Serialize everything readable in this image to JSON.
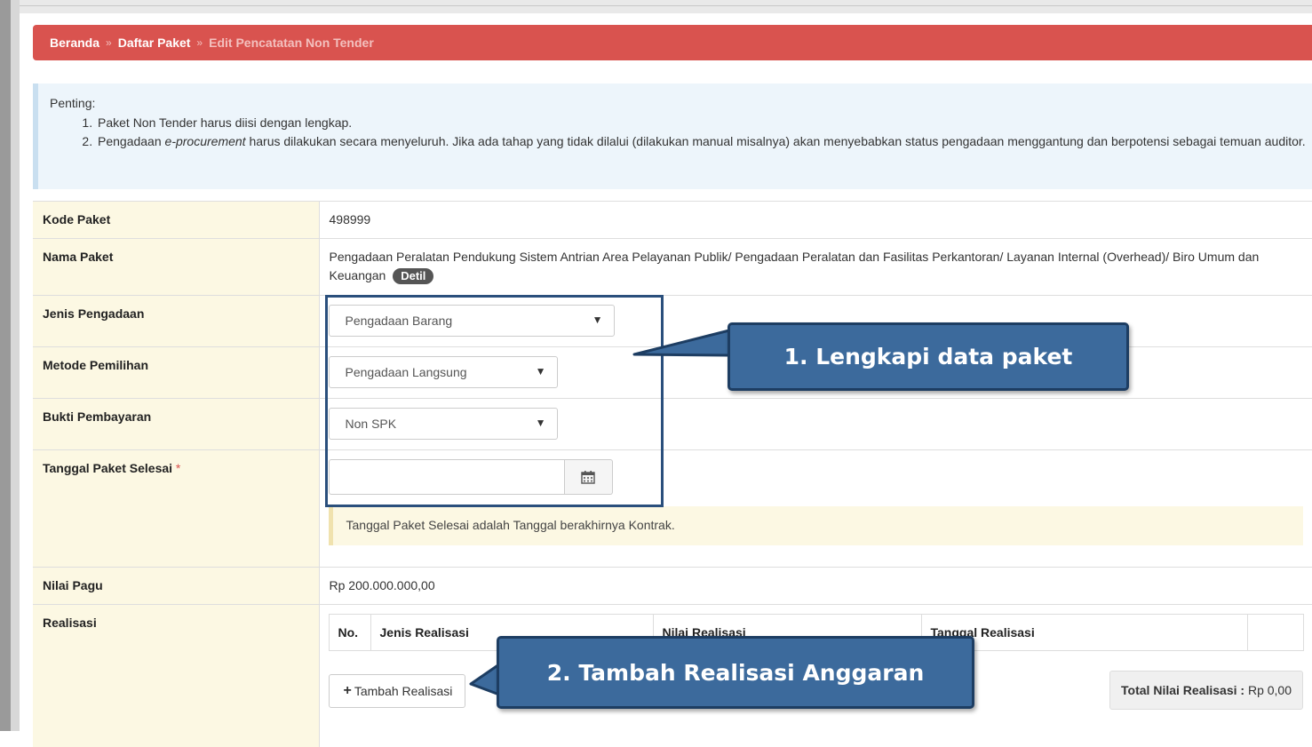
{
  "breadcrumb": {
    "home": "Beranda",
    "list": "Daftar Paket",
    "current": "Edit Pencatatan Non Tender",
    "separator": "»"
  },
  "alert": {
    "title": "Penting:",
    "item1": "Paket Non Tender harus diisi dengan lengkap.",
    "item2_prefix": "Pengadaan ",
    "item2_emph": "e-procurement",
    "item2_suffix": " harus dilakukan secara menyeluruh. Jika ada tahap yang tidak dilalui (dilakukan manual misalnya) akan menyebabkan status pengadaan menggantung dan berpotensi sebagai temuan auditor."
  },
  "form": {
    "kode_label": "Kode Paket",
    "kode_value": "498999",
    "nama_label": "Nama Paket",
    "nama_value": "Pengadaan Peralatan Pendukung Sistem Antrian Area Pelayanan Publik/ Pengadaan Peralatan dan Fasilitas Perkantoran/ Layanan Internal (Overhead)/ Biro Umum dan Keuangan",
    "detil_label": "Detil",
    "jenis_label": "Jenis Pengadaan",
    "jenis_value": "Pengadaan Barang",
    "metode_label": "Metode Pemilihan",
    "metode_value": "Pengadaan Langsung",
    "bukti_label": "Bukti Pembayaran",
    "bukti_value": "Non SPK",
    "tanggal_label": "Tanggal Paket Selesai",
    "required_mark": "*",
    "tanggal_value": "",
    "tanggal_note": "Tanggal Paket Selesai adalah Tanggal berakhirnya Kontrak.",
    "pagu_label": "Nilai Pagu",
    "pagu_value": "Rp 200.000.000,00",
    "realisasi_label": "Realisasi"
  },
  "realisasi_table": {
    "headers": [
      "No.",
      "Jenis Realisasi",
      "Nilai Realisasi",
      "Tanggal Realisasi",
      ""
    ]
  },
  "buttons": {
    "tambah_realisasi": "Tambah Realisasi"
  },
  "total": {
    "label": "Total Nilai Realisasi :",
    "value": "Rp 0,00"
  },
  "callouts": {
    "c1": "1.   Lengkapi data paket",
    "c2": "2. Tambah Realisasi Anggaran"
  },
  "colors": {
    "breadcrumb_bg": "#d9534f",
    "label_bg": "#fcf8e3",
    "alert_bg": "#edf5fb",
    "callout_bg": "#3c6a9c",
    "callout_border": "#1d3d62"
  }
}
